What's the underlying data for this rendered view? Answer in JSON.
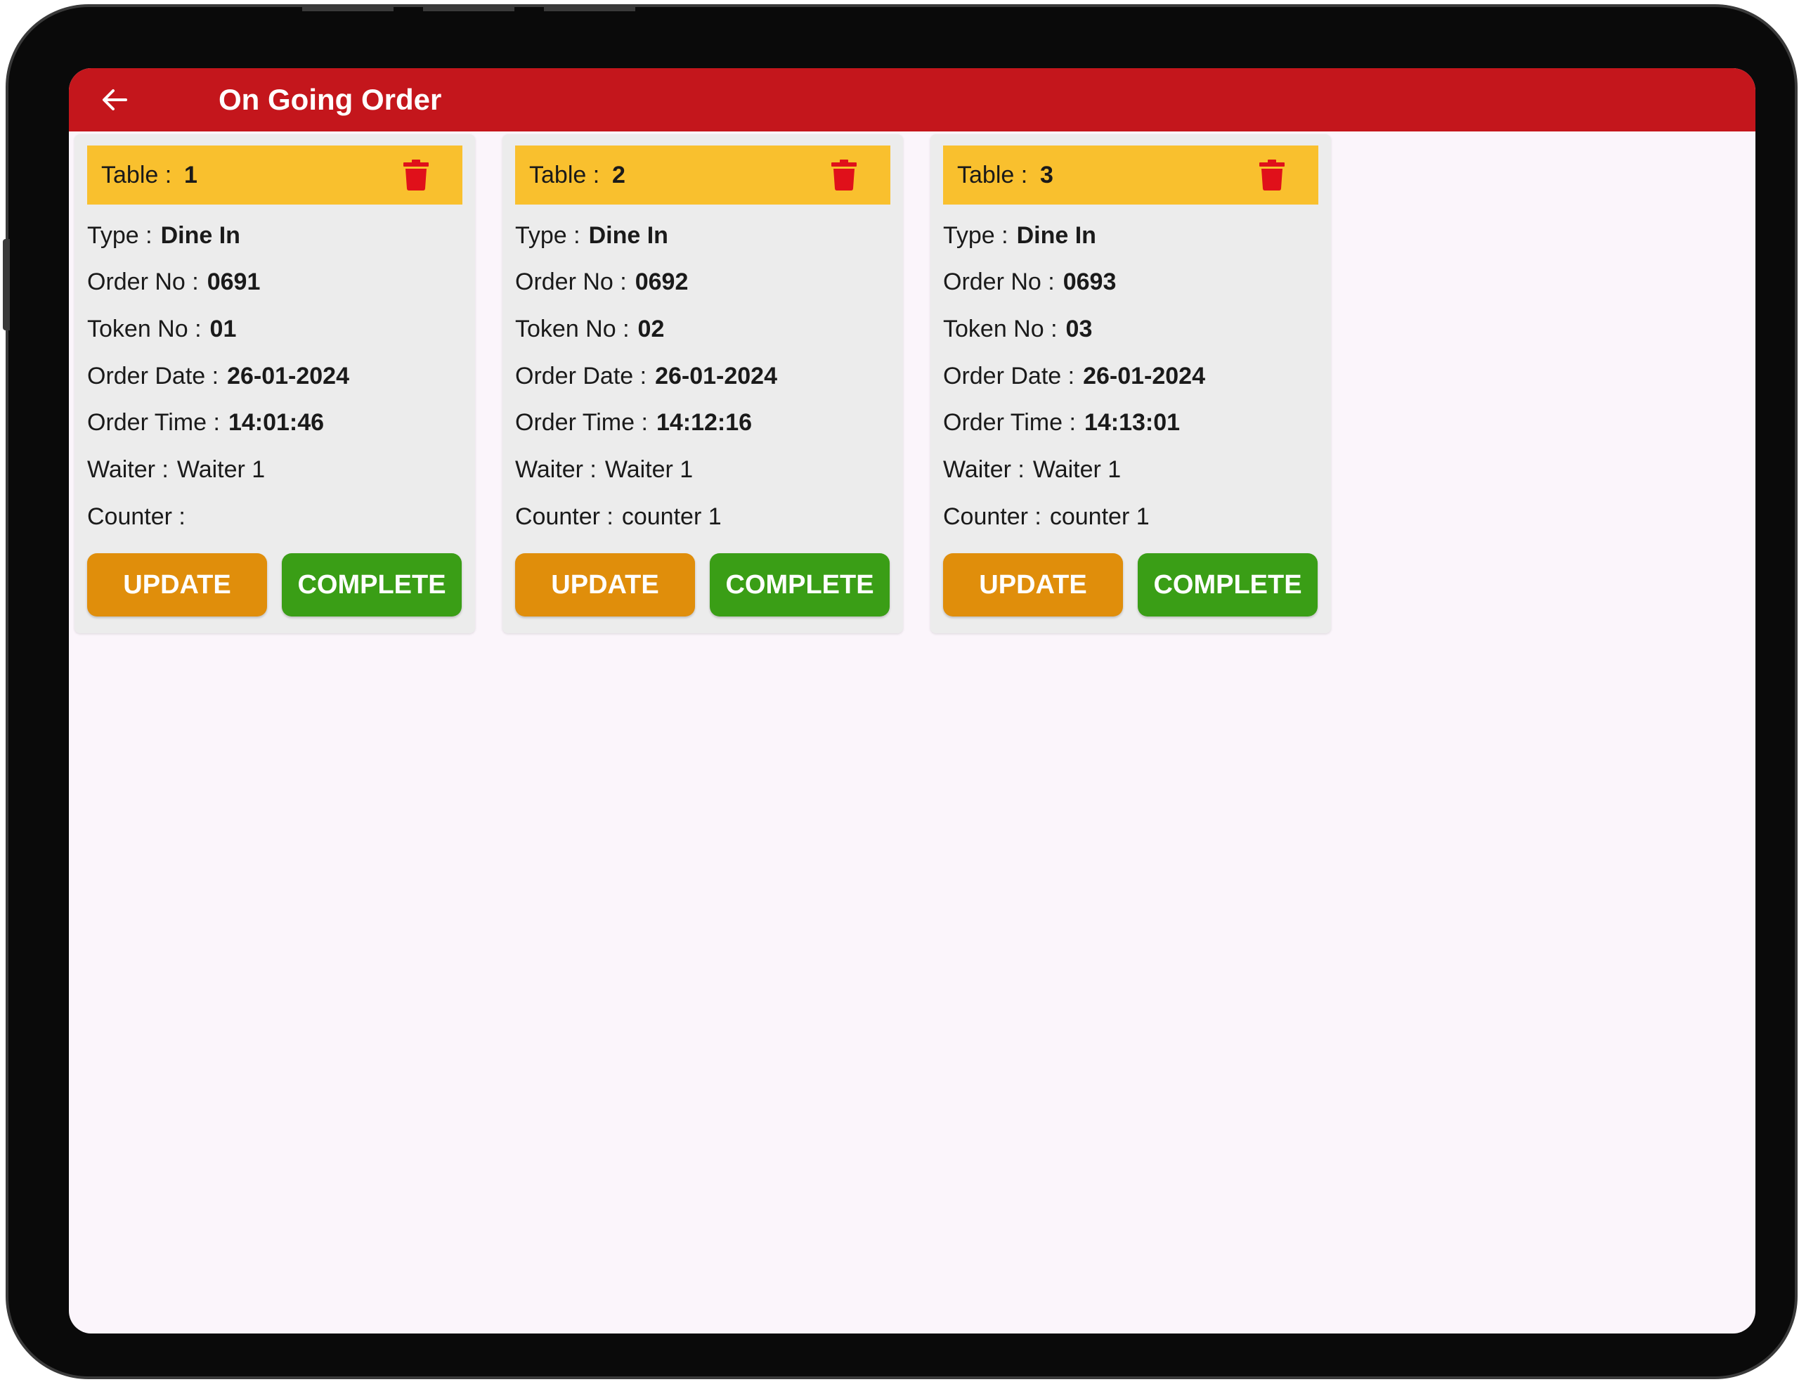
{
  "appbar": {
    "title": "On Going Order",
    "back_icon": "arrow-left-icon"
  },
  "colors": {
    "appbar": "#c4161c",
    "card_header": "#f9c02e",
    "update_button": "#e08e0b",
    "complete_button": "#3a9e16",
    "delete_icon": "#e0101a",
    "screen_bg": "#fbf5fb"
  },
  "labels": {
    "table": "Table :",
    "type": "Type :",
    "order_no": "Order No :",
    "token_no": "Token No :",
    "order_date": "Order Date :",
    "order_time": "Order Time :",
    "waiter": "Waiter :",
    "counter": "Counter :",
    "update": "UPDATE",
    "complete": "COMPLETE"
  },
  "orders": [
    {
      "table": "1",
      "type": "Dine In",
      "order_no": "0691",
      "token_no": "01",
      "order_date": "26-01-2024",
      "order_time": "14:01:46",
      "waiter": "Waiter 1",
      "counter": ""
    },
    {
      "table": "2",
      "type": "Dine In",
      "order_no": "0692",
      "token_no": "02",
      "order_date": "26-01-2024",
      "order_time": "14:12:16",
      "waiter": "Waiter 1",
      "counter": "counter 1"
    },
    {
      "table": "3",
      "type": "Dine In",
      "order_no": "0693",
      "token_no": "03",
      "order_date": "26-01-2024",
      "order_time": "14:13:01",
      "waiter": "Waiter 1",
      "counter": "counter 1"
    }
  ]
}
